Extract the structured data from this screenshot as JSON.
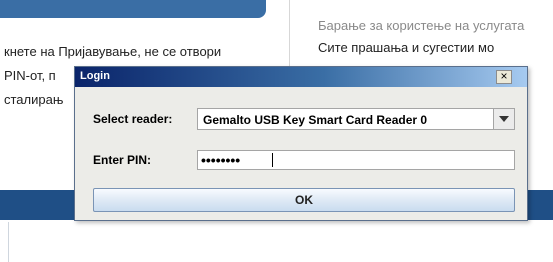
{
  "background": {
    "left_column_lines": [
      "кнете на Пријавување, не се отвори",
      "PIN-от, п",
      "сталирањ"
    ],
    "right_column_lines": [
      "Барање за користење на услугата",
      "Сите прашања и сугестии мо"
    ],
    "colors": {
      "band": "#1f4f86",
      "tab": "#3a6ea5"
    }
  },
  "dialog": {
    "title": "Login",
    "close_symbol": "×",
    "reader_label": "Select reader:",
    "reader_value": "Gemalto USB Key Smart Card Reader 0",
    "pin_label": "Enter PIN:",
    "pin_value": "••••••••",
    "ok_label": "OK"
  }
}
